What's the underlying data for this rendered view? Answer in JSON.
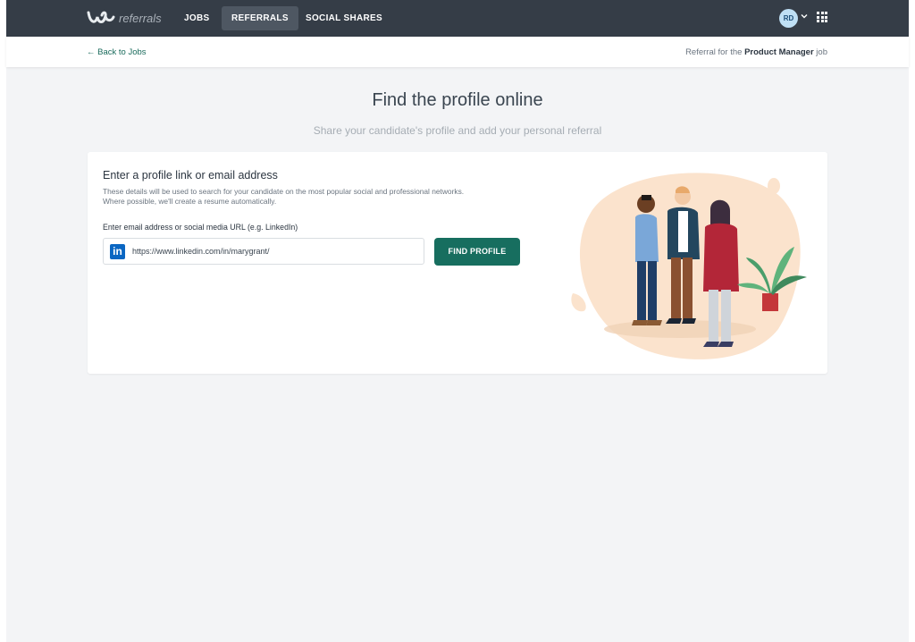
{
  "app": {
    "logo_text": "referrals"
  },
  "nav": {
    "jobs": "JOBS",
    "referrals": "REFERRALS",
    "social_shares": "SOCIAL SHARES"
  },
  "user": {
    "initials": "RD"
  },
  "subbar": {
    "back_link": "← Back to Jobs",
    "referral_prefix": "Referral for the ",
    "job_title": "Product Manager",
    "referral_suffix": " job"
  },
  "page": {
    "title": "Find the profile online",
    "subtitle": "Share your candidate's profile and add your personal referral"
  },
  "card": {
    "title": "Enter a profile link or email address",
    "description_line1": "These details will be used to search for your candidate on the most popular social and professional networks.",
    "description_line2": "Where possible, we'll create a resume automatically.",
    "field_label": "Enter email address or social media URL (e.g. LinkedIn)",
    "field_value": "https://www.linkedin.com/in/marygrant/",
    "button_label": "FIND PROFILE"
  },
  "colors": {
    "accent": "#176e5f",
    "topbar": "#353d47",
    "linkedin": "#0a66c2"
  },
  "icons": [
    "logo-mark-icon",
    "chevron-down-icon",
    "apps-grid-icon",
    "linkedin-icon"
  ]
}
